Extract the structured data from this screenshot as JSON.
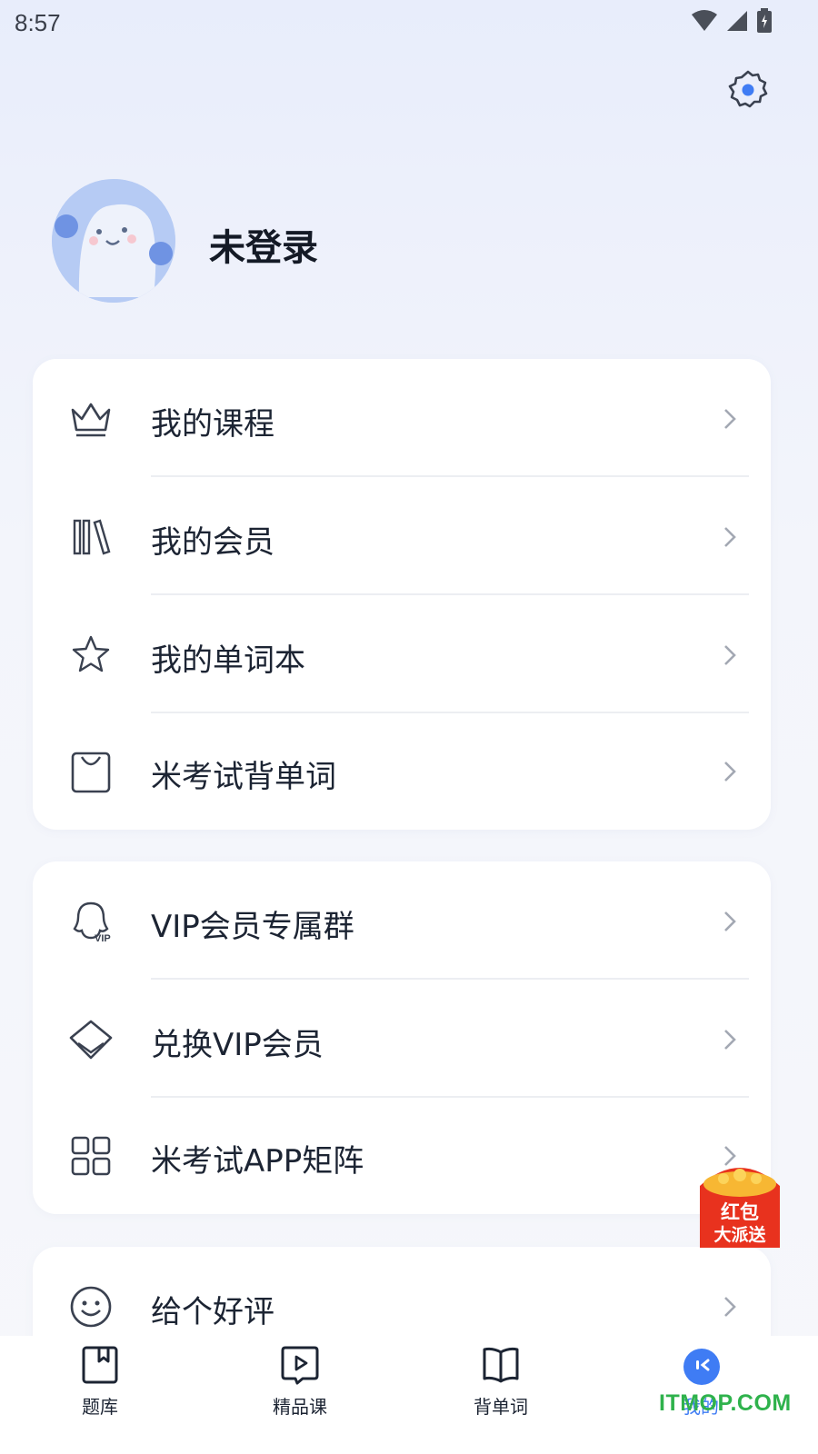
{
  "status_bar": {
    "time": "8:57"
  },
  "profile": {
    "username": "未登录"
  },
  "menu_group_1": [
    {
      "label": "我的课程",
      "icon": "crown-icon"
    },
    {
      "label": "我的会员",
      "icon": "books-icon"
    },
    {
      "label": "我的单词本",
      "icon": "star-icon"
    },
    {
      "label": "米考试背单词",
      "icon": "shopping-bag-icon"
    }
  ],
  "menu_group_2": [
    {
      "label": "VIP会员专属群",
      "icon": "qq-vip-icon"
    },
    {
      "label": "兑换VIP会员",
      "icon": "diamond-icon"
    },
    {
      "label": "米考试APP矩阵",
      "icon": "grid-icon"
    }
  ],
  "menu_group_3": [
    {
      "label": "给个好评",
      "icon": "smile-icon"
    }
  ],
  "red_packet": {
    "line1": "红包",
    "line2": "大派送"
  },
  "bottom_nav": [
    {
      "label": "题库",
      "icon": "bookmark-book-icon"
    },
    {
      "label": "精品课",
      "icon": "play-video-icon"
    },
    {
      "label": "背单词",
      "icon": "open-book-icon"
    },
    {
      "label": "我的",
      "icon": "profile-face-icon",
      "active": true
    }
  ],
  "watermark": "ITMOP.COM",
  "colors": {
    "accent": "#3f7cf4",
    "text": "#1c2433",
    "watermark": "#2fb24c",
    "red_packet": "#e8321e"
  }
}
